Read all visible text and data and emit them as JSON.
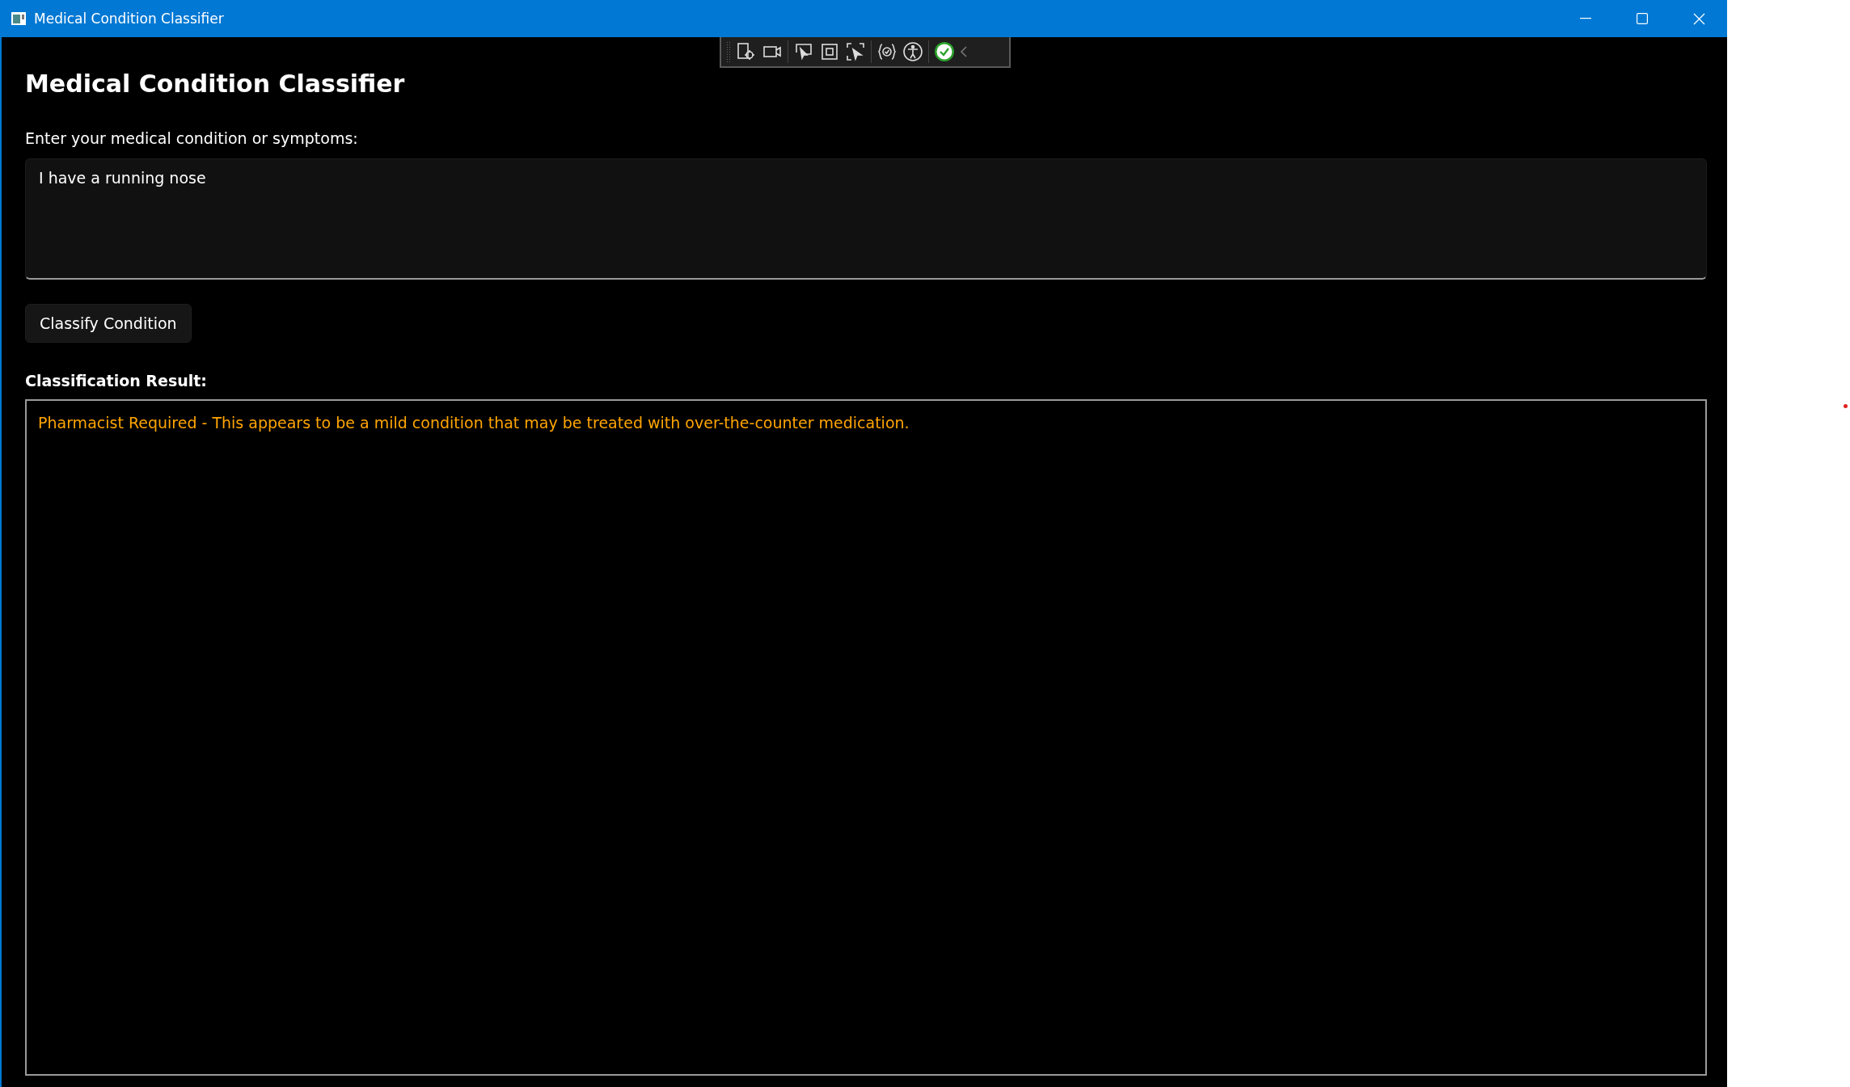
{
  "window": {
    "title": "Medical Condition Classifier"
  },
  "heading": "Medical Condition Classifier",
  "symptoms": {
    "label": "Enter your medical condition or symptoms:",
    "value": "I have a running nose"
  },
  "classify_button": "Classify Condition",
  "result": {
    "label": "Classification Result:",
    "text": "Pharmacist Required - This appears to be a mild condition that may be treated with over-the-counter medication."
  }
}
